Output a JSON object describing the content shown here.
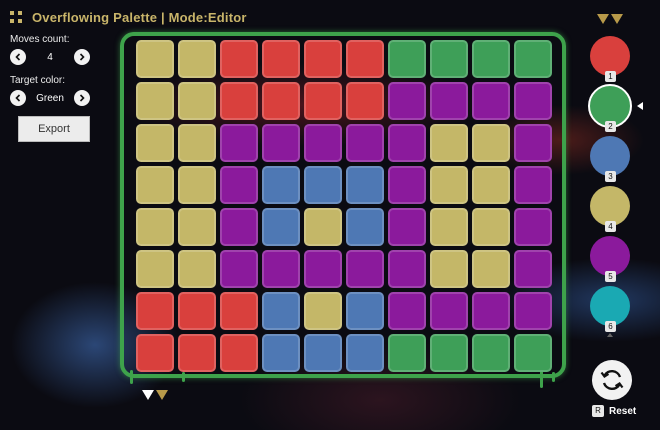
{
  "header": {
    "title": "Overflowing Palette | Mode:Editor",
    "icon": "grid-icon"
  },
  "moves": {
    "label": "Moves count:",
    "value": "4"
  },
  "target": {
    "label": "Target color:",
    "value": "Green"
  },
  "export_label": "Export",
  "reset_label": "Reset",
  "reset_key": "R",
  "colors": {
    "R": "#d9403d",
    "G": "#3e9f58",
    "B": "#4e78b4",
    "Y": "#c4b768",
    "P": "#8b1a9c",
    "C": "#1aa9b3"
  },
  "grid": [
    [
      "Y",
      "Y",
      "R",
      "R",
      "R",
      "R",
      "G",
      "G",
      "G",
      "G"
    ],
    [
      "Y",
      "Y",
      "R",
      "R",
      "R",
      "R",
      "P",
      "P",
      "P",
      "P"
    ],
    [
      "Y",
      "Y",
      "P",
      "P",
      "P",
      "P",
      "P",
      "Y",
      "Y",
      "P"
    ],
    [
      "Y",
      "Y",
      "P",
      "B",
      "B",
      "B",
      "P",
      "Y",
      "Y",
      "P"
    ],
    [
      "Y",
      "Y",
      "P",
      "B",
      "Y",
      "B",
      "P",
      "Y",
      "Y",
      "P"
    ],
    [
      "Y",
      "Y",
      "P",
      "P",
      "P",
      "P",
      "P",
      "Y",
      "Y",
      "P"
    ],
    [
      "R",
      "R",
      "R",
      "B",
      "Y",
      "B",
      "P",
      "P",
      "P",
      "P"
    ],
    [
      "R",
      "R",
      "R",
      "B",
      "B",
      "B",
      "G",
      "G",
      "G",
      "G"
    ]
  ],
  "palette": [
    {
      "key": "1",
      "color": "R",
      "name": "red"
    },
    {
      "key": "2",
      "color": "G",
      "name": "green",
      "selected": true
    },
    {
      "key": "3",
      "color": "B",
      "name": "blue"
    },
    {
      "key": "4",
      "color": "Y",
      "name": "yellow"
    },
    {
      "key": "5",
      "color": "P",
      "name": "purple"
    },
    {
      "key": "6",
      "color": "C",
      "name": "cyan"
    }
  ],
  "markers": {
    "white": "#ffffff",
    "gold": "#b89a4a"
  }
}
